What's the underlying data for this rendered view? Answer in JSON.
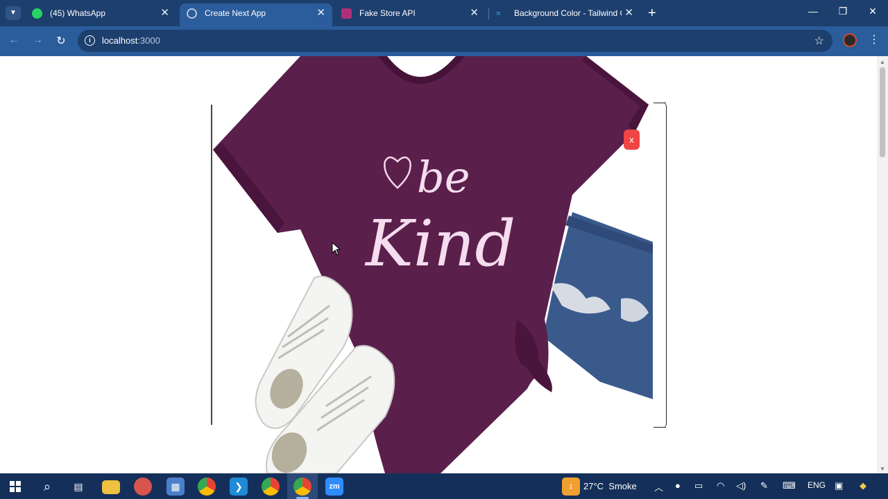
{
  "tabs": [
    {
      "label": "(45) WhatsApp",
      "icon": "whatsapp-icon",
      "active": false
    },
    {
      "label": "Create Next App",
      "icon": "globe-icon",
      "active": true
    },
    {
      "label": "Fake Store API",
      "icon": "fake-store-icon",
      "active": false
    },
    {
      "label": "Background Color - Tailwind CSS",
      "icon": "tailwind-icon",
      "active": false
    }
  ],
  "address": {
    "host": "localhost",
    "port": ":3000"
  },
  "modal": {
    "close_label": "x"
  },
  "product_image": {
    "print_line1": "be",
    "print_line2": "Kind",
    "shirt_color": "#5b1f4c",
    "accent_color": "#ef4444"
  },
  "taskbar": {
    "weather_temp": "27°C",
    "weather_desc": "Smoke",
    "weather_badge": "1",
    "language": "ENG",
    "apps": [
      "start-icon",
      "search-icon",
      "task-view-icon",
      "file-explorer-icon",
      "snipping-icon",
      "calculator-icon",
      "chrome-icon",
      "vscode-icon",
      "chrome-profile-icon",
      "chrome-active-icon",
      "zoom-icon"
    ],
    "zoom_label": "zm"
  }
}
